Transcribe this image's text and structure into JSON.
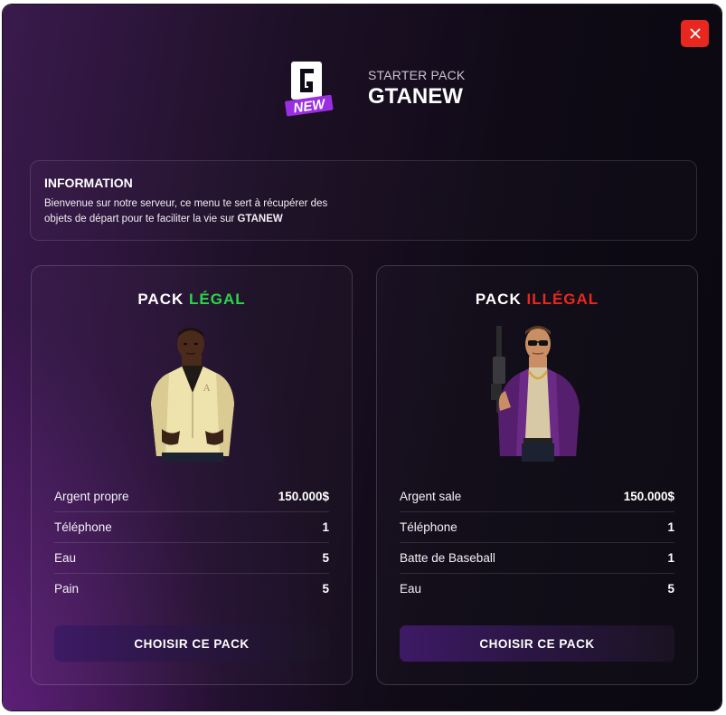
{
  "header": {
    "subtitle": "STARTER PACK",
    "title": "GTANEW",
    "logo_letter": "G",
    "logo_badge": "NEW"
  },
  "close_button": {
    "icon": "close-icon",
    "color": "#e8281f"
  },
  "info": {
    "title": "INFORMATION",
    "text": "Bienvenue sur notre serveur, ce menu te sert à récupérer des objets de départ pour te faciliter la vie sur ",
    "highlight": "GTANEW"
  },
  "packs": [
    {
      "title_prefix": "PACK",
      "title_word": "LÉGAL",
      "title_color": "#2bd64a",
      "items": [
        {
          "name": "Argent propre",
          "qty": "150.000$"
        },
        {
          "name": "Téléphone",
          "qty": "1"
        },
        {
          "name": "Eau",
          "qty": "5"
        },
        {
          "name": "Pain",
          "qty": "5"
        }
      ],
      "button_label": "CHOISIR CE PACK"
    },
    {
      "title_prefix": "PACK",
      "title_word": "ILLÉGAL",
      "title_color": "#e8281f",
      "items": [
        {
          "name": "Argent sale",
          "qty": "150.000$"
        },
        {
          "name": "Téléphone",
          "qty": "1"
        },
        {
          "name": "Batte de Baseball",
          "qty": "1"
        },
        {
          "name": "Eau",
          "qty": "5"
        }
      ],
      "button_label": "CHOISIR CE PACK"
    }
  ],
  "colors": {
    "accent_purple": "#3e1a66",
    "legal_green": "#2bd64a",
    "illegal_red": "#e8281f"
  }
}
